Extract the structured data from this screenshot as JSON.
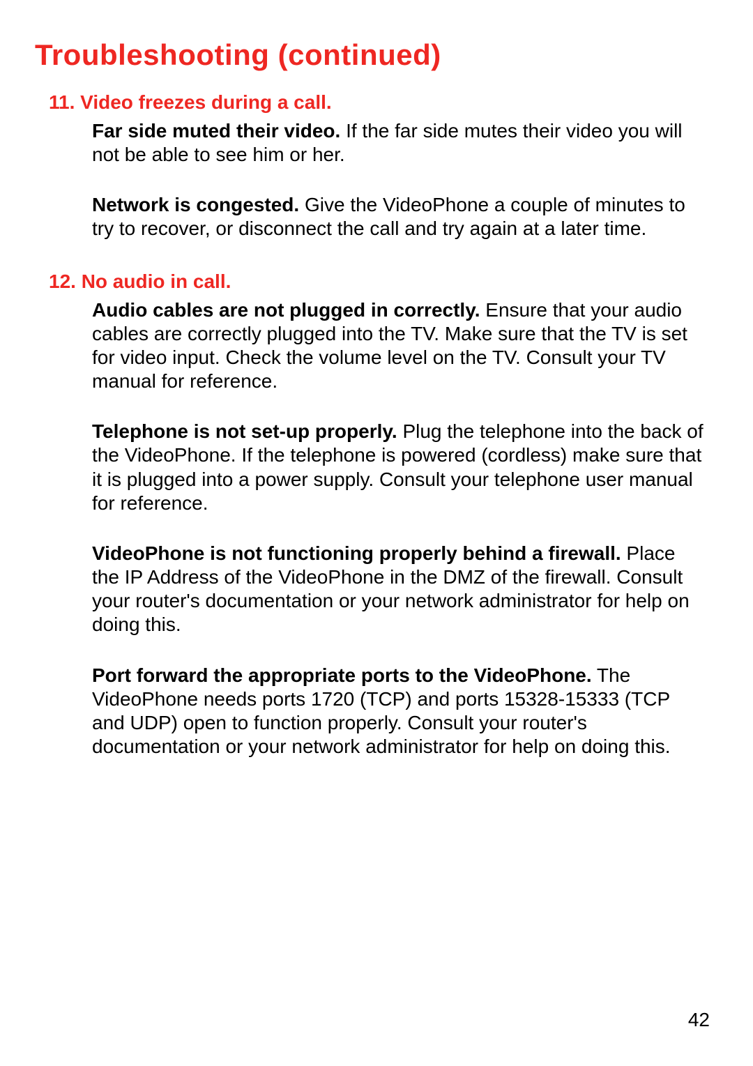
{
  "page_title": "Troubleshooting  (continued)",
  "section11": {
    "header": "11. Video freezes during a call.",
    "p1_lead": "Far side muted their video.",
    "p1_body": " If the far side mutes their video you will not be able to see him or her.",
    "p2_lead": "Network is congested.",
    "p2_body": " Give the VideoPhone a couple of minutes to try to recover, or disconnect the call and try again at a later time."
  },
  "section12": {
    "header": "12. No audio in call.",
    "p1_lead": "Audio cables are not plugged in correctly.",
    "p1_body": " Ensure that your audio cables are correctly plugged into the TV. Make sure that the TV is set for video input. Check the volume level on the TV. Consult your TV manual for reference.",
    "p2_lead": "Telephone is not set-up properly.",
    "p2_body": " Plug the telephone into the back of the VideoPhone. If the telephone is powered (cordless) make sure that it is plugged into a power supply. Consult your telephone user manual for reference.",
    "p3_lead": "VideoPhone is not functioning properly behind a firewall.",
    "p3_body": " Place the IP Address of the VideoPhone in the DMZ of the firewall. Consult your router's documentation or your network administrator for help on doing this.",
    "p4_lead": "Port forward the appropriate ports to the VideoPhone.",
    "p4_body": " The VideoPhone needs ports 1720 (TCP) and ports 15328-15333 (TCP and UDP) open to function properly. Consult your router's documentation or your network administrator for help on doing this."
  },
  "page_number": "42"
}
